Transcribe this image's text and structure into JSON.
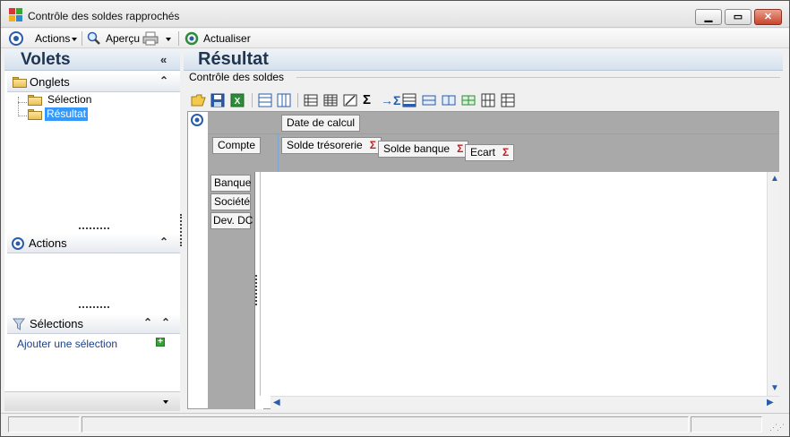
{
  "window": {
    "title": "Contrôle des soldes rapprochés"
  },
  "toolbar": {
    "actions_label": "Actions",
    "apercu_label": "Aperçu",
    "actualiser_label": "Actualiser"
  },
  "left": {
    "title": "Volets",
    "onglets": {
      "label": "Onglets",
      "items": [
        {
          "label": "Sélection"
        },
        {
          "label": "Résultat"
        }
      ]
    },
    "actions": {
      "label": "Actions"
    },
    "selections": {
      "label": "Sélections",
      "add_link": "Ajouter une sélection"
    }
  },
  "main": {
    "title": "Résultat",
    "group_label": "Contrôle des soldes",
    "pivot": {
      "column_field": "Date de calcul",
      "row_header_field": "Compte",
      "data_fields": [
        {
          "label": "Solde trésorerie"
        },
        {
          "label": "Solde banque"
        },
        {
          "label": "Ecart"
        }
      ],
      "row_fields": [
        {
          "label": "Banque"
        },
        {
          "label": "Société"
        },
        {
          "label": "Dev. DC"
        }
      ],
      "sigma": "Σ"
    }
  },
  "colors": {
    "accent": "#1f3550",
    "sigma": "#c31f1f",
    "pivot_bg": "#a9a9a9"
  }
}
